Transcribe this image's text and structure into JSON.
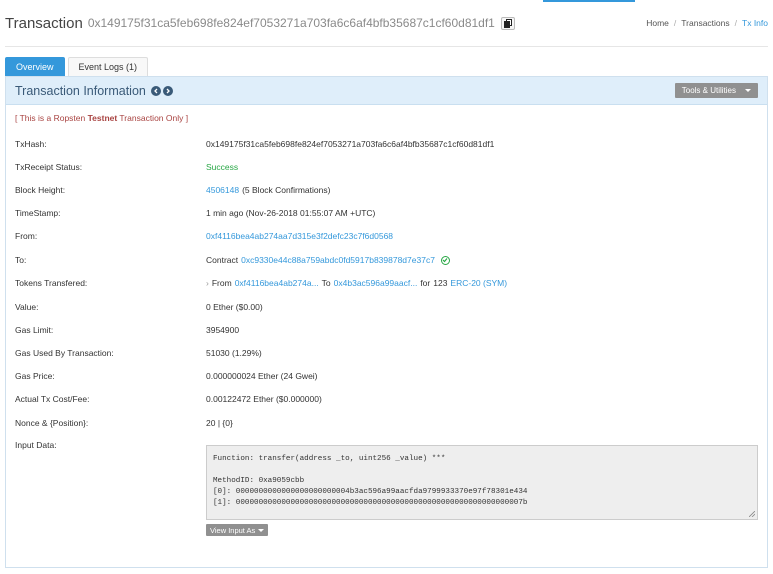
{
  "header": {
    "title": "Transaction",
    "tx_hash": "0x149175f31ca5feb698fe824ef7053271a703fa6c6af4bfb35687c1cf60d81df1",
    "breadcrumb": [
      "Home",
      "Transactions",
      "Tx Info"
    ]
  },
  "tabs": [
    "Overview",
    "Event Logs (1)"
  ],
  "panel": {
    "title": "Transaction Information",
    "tools_label": "Tools & Utilities"
  },
  "testnet": {
    "prefix": "[ This is a Ropsten ",
    "bold": "Testnet",
    "suffix": " Transaction Only ]"
  },
  "fields": {
    "txhash": {
      "label": "TxHash:",
      "value": "0x149175f31ca5feb698fe824ef7053271a703fa6c6af4bfb35687c1cf60d81df1"
    },
    "status": {
      "label": "TxReceipt Status:",
      "value": "Success"
    },
    "block": {
      "label": "Block Height:",
      "block_number": "4506148",
      "confirmations": "(5 Block Confirmations)"
    },
    "timestamp": {
      "label": "TimeStamp:",
      "value": "1 min ago (Nov-26-2018 01:55:07 AM +UTC)"
    },
    "from": {
      "label": "From:",
      "value": "0xf4116bea4ab274aa7d315e3f2defc23c7f6d0568"
    },
    "to": {
      "label": "To:",
      "prefix": "Contract",
      "address": "0xc9330e44c88a759abdc0fd5917b839878d7e37c7"
    },
    "tokens": {
      "label": "Tokens Transfered:",
      "arrow": "›",
      "from_label": "From",
      "from_addr": "0xf4116bea4ab274a...",
      "to_label": "To",
      "to_addr": "0x4b3ac596a99aacf...",
      "for_label": "for",
      "amount": "123",
      "token": "ERC-20 (SYM)"
    },
    "value": {
      "label": "Value:",
      "value": "0 Ether ($0.00)"
    },
    "gas_limit": {
      "label": "Gas Limit:",
      "value": "3954900"
    },
    "gas_used": {
      "label": "Gas Used By Transaction:",
      "value": "51030 (1.29%)"
    },
    "gas_price": {
      "label": "Gas Price:",
      "value": "0.000000024 Ether (24 Gwei)"
    },
    "tx_fee": {
      "label": "Actual Tx Cost/Fee:",
      "value": "0.00122472 Ether ($0.000000)"
    },
    "nonce": {
      "label": "Nonce & {Position}:",
      "value": "20 | {0}"
    },
    "input": {
      "label": "Input Data:"
    }
  },
  "input_data": {
    "function": "Function: transfer(address _to, uint256 _value) ***",
    "method_id": "MethodID: 0xa9059cbb",
    "param0": "[0]:  0000000000000000000000004b3ac596a99aacfda9799933370e97f78301e434",
    "param1": "[1]:  000000000000000000000000000000000000000000000000000000000000007b",
    "view_as_label": "View Input As"
  }
}
